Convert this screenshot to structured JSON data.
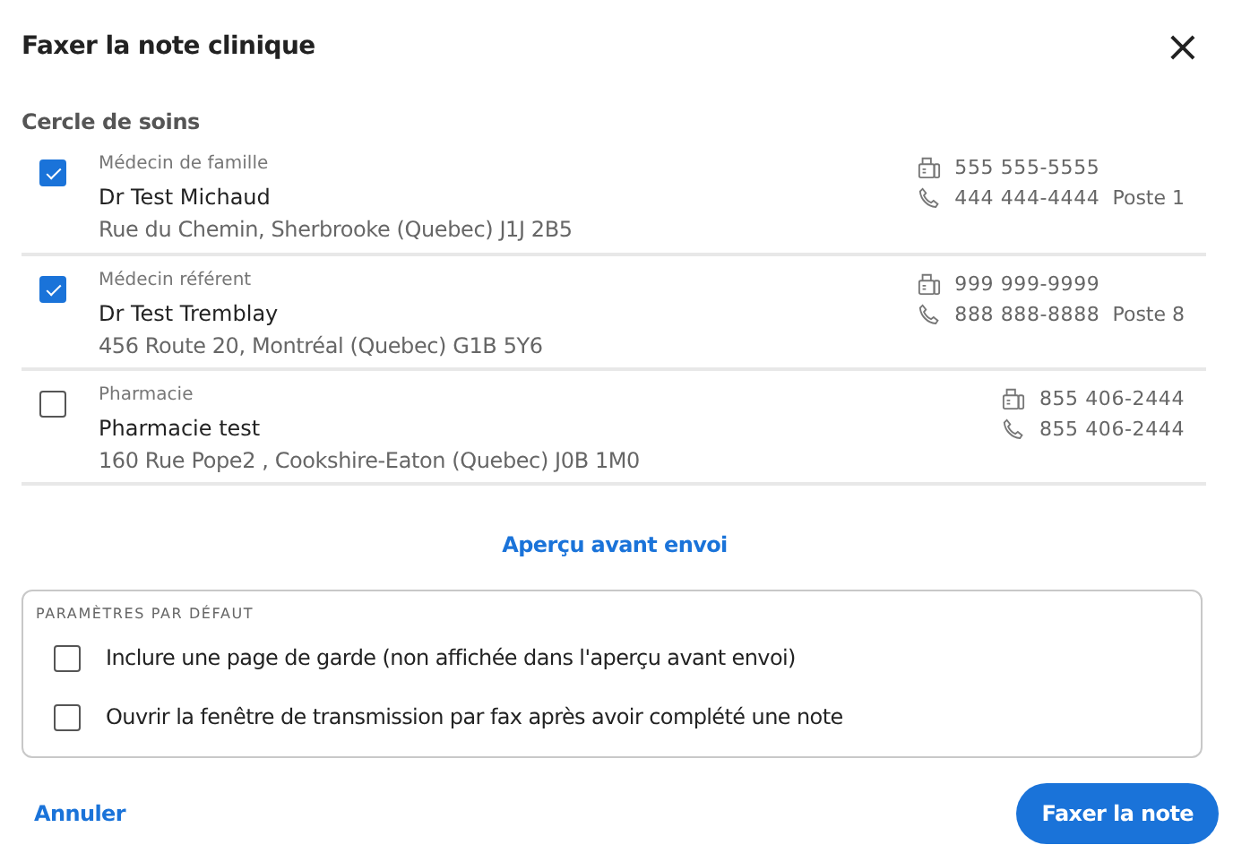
{
  "dialog": {
    "title": "Faxer la note clinique",
    "close": "×"
  },
  "section_title": "Cercle de soins",
  "contacts": [
    {
      "checked": true,
      "role": "Médecin de famille",
      "name": "Dr Test Michaud",
      "address": "Rue du Chemin, Sherbrooke (Quebec) J1J 2B5",
      "fax": "555 555-5555",
      "phone": "444 444-4444",
      "extension": "Poste 1"
    },
    {
      "checked": true,
      "role": "Médecin référent",
      "name": "Dr Test Tremblay",
      "address": "456 Route 20, Montréal (Quebec) G1B 5Y6",
      "fax": "999 999-9999",
      "phone": "888 888-8888",
      "extension": "Poste 8"
    },
    {
      "checked": false,
      "role": "Pharmacie",
      "name": "Pharmacie test",
      "address": "160 Rue Pope2 , Cookshire-Eaton (Quebec) J0B 1M0",
      "fax": "855 406-2444",
      "phone": "855 406-2444"
    }
  ],
  "preview_link": "Aperçu avant envoi",
  "defaults": {
    "legend": "PARAMÈTRES PAR DÉFAUT",
    "options": [
      {
        "label": "Inclure une page de garde (non affichée dans l'aperçu avant envoi)",
        "checked": false
      },
      {
        "label": "Ouvrir la fenêtre de transmission par fax après avoir complété une note",
        "checked": false
      }
    ]
  },
  "buttons": {
    "cancel": "Annuler",
    "submit": "Faxer la note"
  }
}
